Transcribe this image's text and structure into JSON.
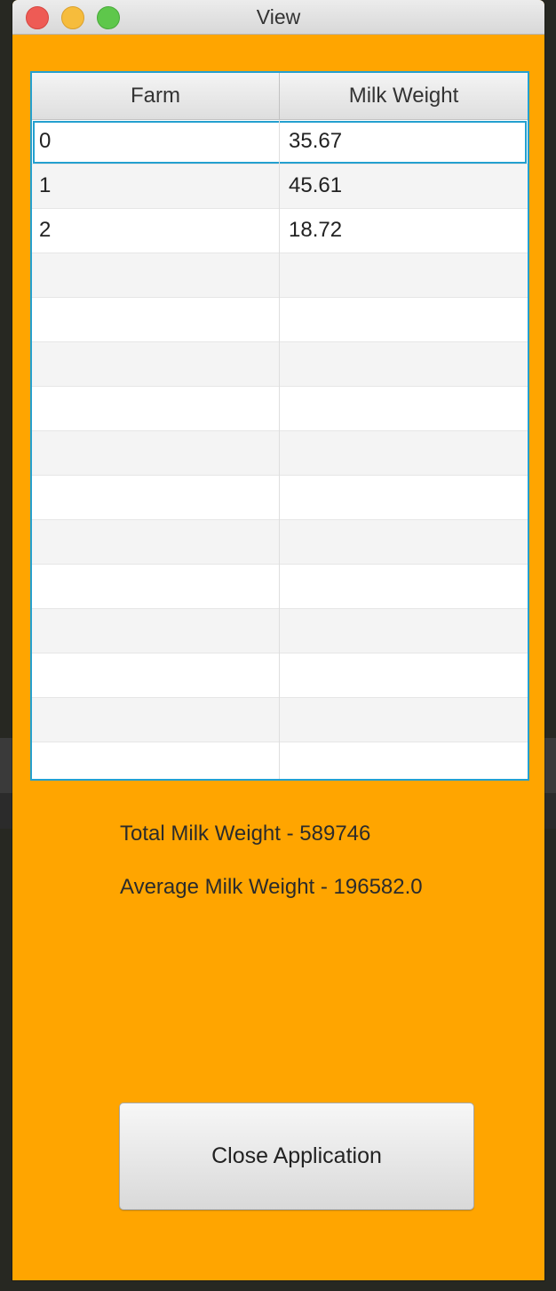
{
  "window": {
    "title": "View"
  },
  "table": {
    "columns": [
      "Farm",
      "Milk Weight"
    ],
    "rows": [
      {
        "farm": "0",
        "milk": "35.67"
      },
      {
        "farm": "1",
        "milk": "45.61"
      },
      {
        "farm": "2",
        "milk": "18.72"
      }
    ],
    "empty_row_count": 12,
    "selected_row": 0
  },
  "stats": {
    "total": "Total Milk Weight - 589746",
    "average": "Average Milk Weight - 196582.0"
  },
  "actions": {
    "close_label": "Close Application"
  },
  "colors": {
    "window_bg": "#ffa500",
    "table_border": "#24a0cf"
  }
}
